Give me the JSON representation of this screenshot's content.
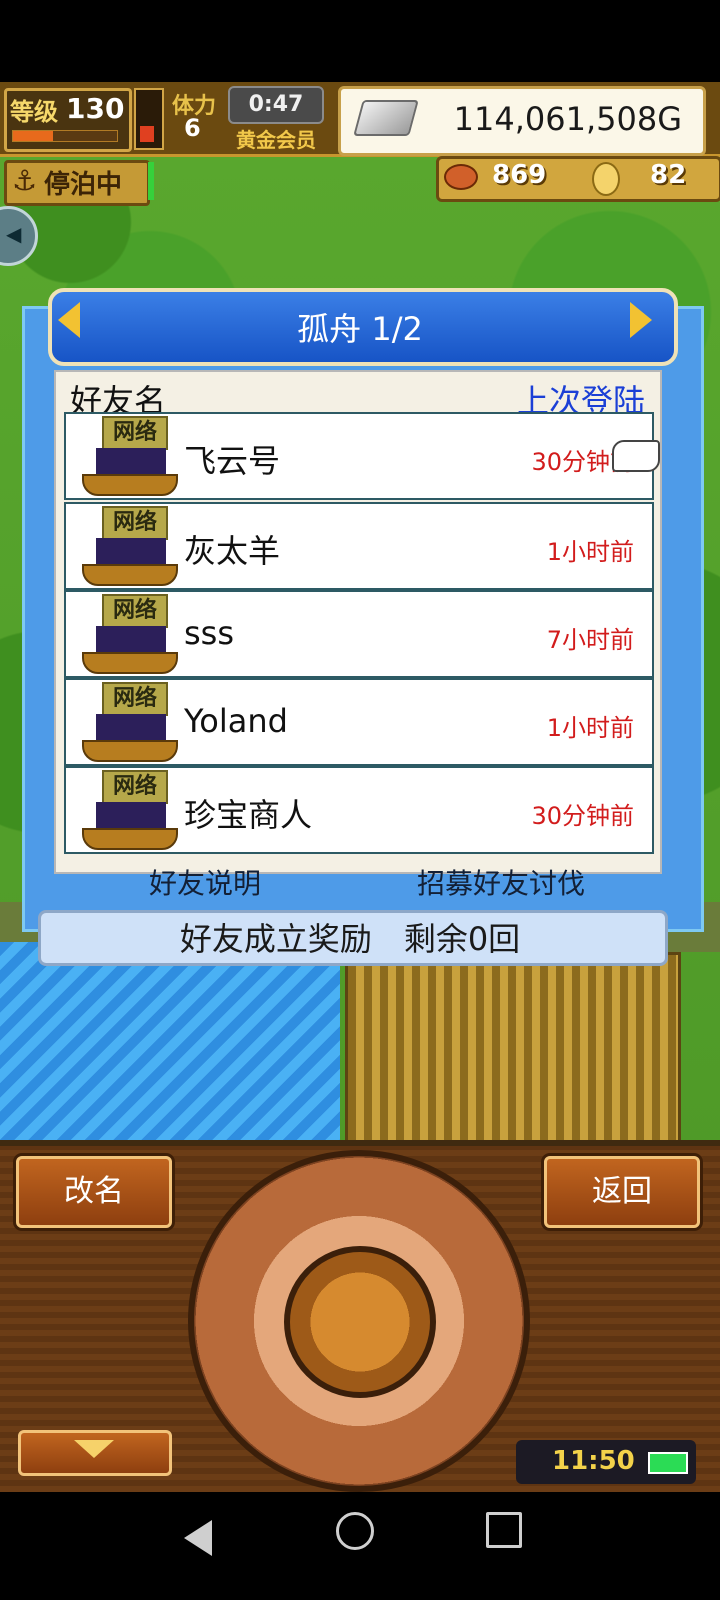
{
  "hud": {
    "level_label": "等级",
    "level": "130",
    "exp_fraction": 0.38,
    "stamina_label": "体力",
    "stamina": "6",
    "timer": "0:47",
    "vip_label": "黄金会员",
    "gold": "114,061,508G",
    "status_label": "停泊中",
    "fish_count": "869",
    "coin_count": "82"
  },
  "panel": {
    "title": "孤舟 1/2",
    "col_name": "好友名",
    "col_last": "上次登陆",
    "tag": "网络",
    "friends": [
      {
        "name": "飞云号",
        "last": "30分钟前"
      },
      {
        "name": "灰太羊",
        "last": "1小时前"
      },
      {
        "name": "sss",
        "last": "7小时前"
      },
      {
        "name": "Yoland",
        "last": "1小时前"
      },
      {
        "name": "珍宝商人",
        "last": "30分钟前"
      }
    ],
    "explain_label": "好友说明",
    "recruit_label": "招募好友讨伐",
    "reward_text": "好友成立奖励　剩余0回"
  },
  "controls": {
    "rename_label": "改名",
    "back_label": "返回",
    "clock": "11:50"
  },
  "icons": {
    "anchor": "anchor-icon",
    "silver": "silver-bar-icon",
    "fish": "fish-icon",
    "coin": "coin-icon",
    "pointer": "hand-pointer-icon"
  }
}
